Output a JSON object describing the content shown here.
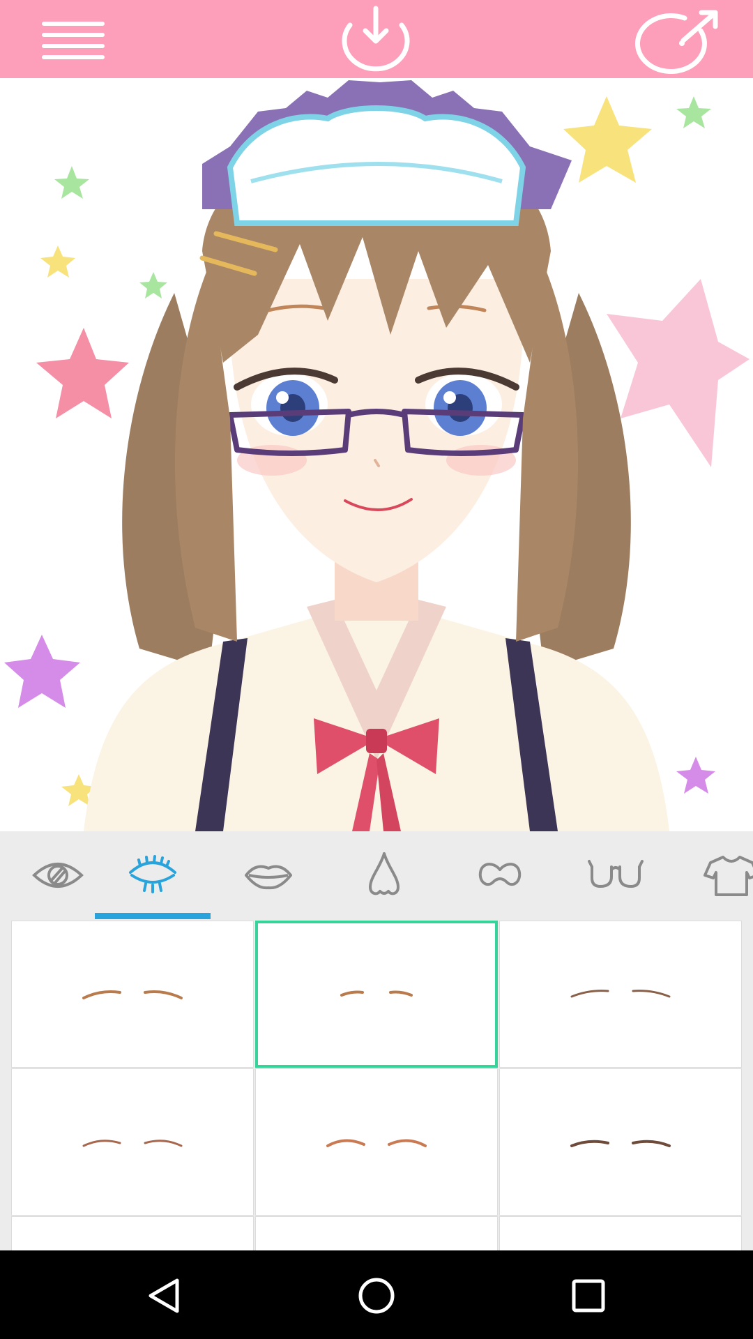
{
  "toolbar": {
    "background": "#fd9fba",
    "icons": [
      "menu-icon",
      "download-icon",
      "share-icon"
    ]
  },
  "canvas": {
    "description_icon": "character-preview"
  },
  "tabs": {
    "active_index": 1,
    "active_color": "#29a3db",
    "items": [
      {
        "icon": "eye-icon"
      },
      {
        "icon": "eyebrow-icon"
      },
      {
        "icon": "mouth-icon"
      },
      {
        "icon": "nose-icon"
      },
      {
        "icon": "mustache-icon"
      },
      {
        "icon": "glasses-icon"
      },
      {
        "icon": "shirt-icon"
      }
    ]
  },
  "options": {
    "selected_index": 1,
    "selected_color": "#36d49b",
    "items": [
      {
        "icon": "eyebrow-option-icon",
        "style": "thick-arched"
      },
      {
        "icon": "eyebrow-option-icon",
        "style": "short-thin"
      },
      {
        "icon": "eyebrow-option-icon",
        "style": "long-thin-dark"
      },
      {
        "icon": "eyebrow-option-icon",
        "style": "thin-arched"
      },
      {
        "icon": "eyebrow-option-icon",
        "style": "soft-arched"
      },
      {
        "icon": "eyebrow-option-icon",
        "style": "flat-dark"
      },
      {
        "icon": "eyebrow-option-icon",
        "style": "partial"
      },
      {
        "icon": "eyebrow-option-icon",
        "style": "partial"
      },
      {
        "icon": "eyebrow-option-icon",
        "style": "partial"
      }
    ]
  },
  "navbar": {
    "icons": [
      "back-icon",
      "home-icon",
      "recent-apps-icon"
    ]
  }
}
